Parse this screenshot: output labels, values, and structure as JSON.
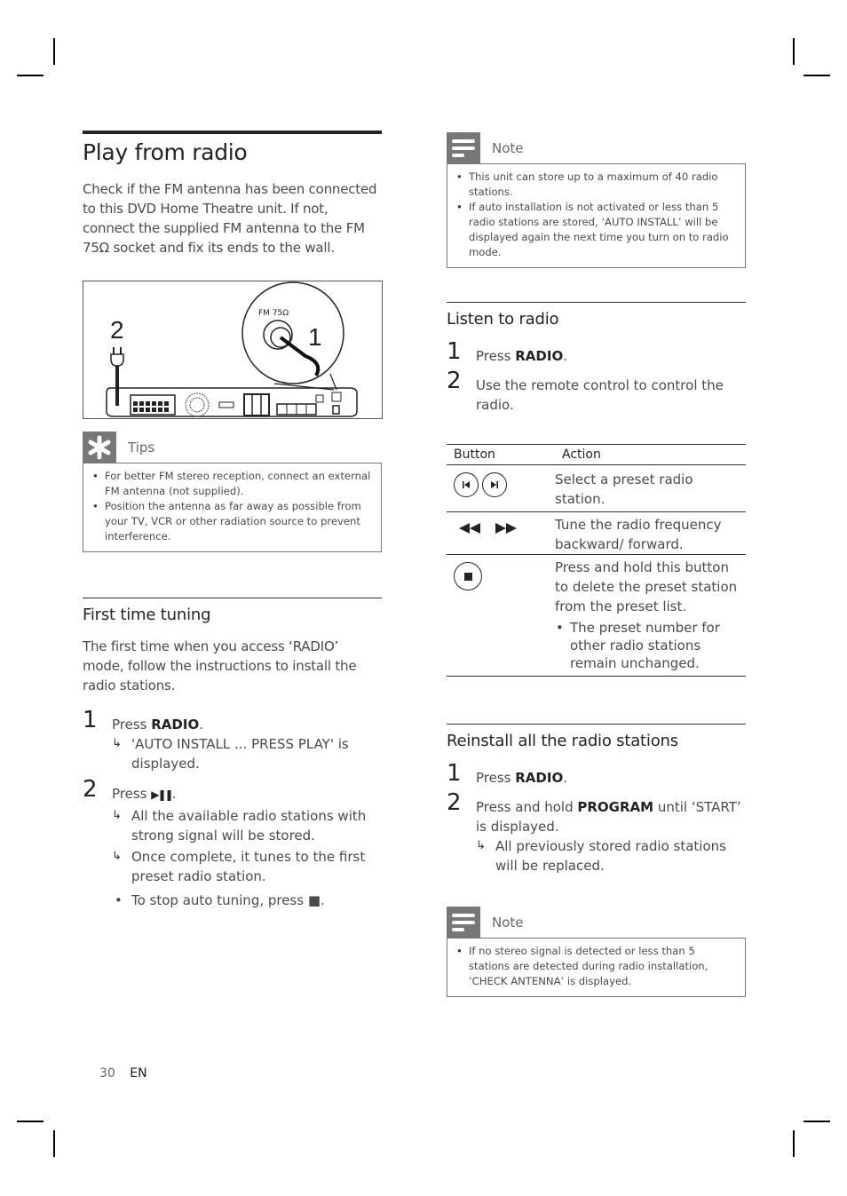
{
  "page": {
    "title": "Play from radio",
    "intro": "Check if the FM antenna has been connected to this DVD Home Theatre unit.  If not, connect the supplied FM antenna to the FM 75Ω socket and fix its ends to the wall.",
    "figure": {
      "label_socket": "FM 75Ω",
      "callout_1": "1",
      "callout_2": "2"
    },
    "tips": {
      "label": "Tips",
      "icon": "asterisk-icon",
      "items": [
        "For better FM stereo reception, connect an external FM antenna (not supplied).",
        "Position the antenna as far away as possible from your TV, VCR or other radiation source to prevent interference."
      ]
    },
    "first_time": {
      "heading": "First time tuning",
      "intro": "The first time when you access ‘RADIO’ mode, follow the instructions to install the radio stations.",
      "steps": [
        {
          "num": "1",
          "pre": "Press ",
          "key": "RADIO",
          "post": ".",
          "results": [
            "'AUTO INSTALL ... PRESS PLAY' is displayed."
          ]
        },
        {
          "num": "2",
          "pre": "Press ",
          "key": "▶❚❚",
          "post": ".",
          "results": [
            "All the available radio stations with strong signal will be stored.",
            "Once complete, it tunes to the first preset radio station."
          ],
          "bullet": "To stop auto tuning, press ■."
        }
      ]
    },
    "note1": {
      "label": "Note",
      "icon": "note-icon",
      "items": [
        "This unit can store up to a maximum of 40 radio stations.",
        "If auto installation is not activated or less than 5 radio stations are stored, ‘AUTO INSTALL’ will be displayed again the next time you turn on to radio mode."
      ]
    },
    "listen": {
      "heading": "Listen to radio",
      "steps": [
        {
          "num": "1",
          "pre": "Press ",
          "key": "RADIO",
          "post": "."
        },
        {
          "num": "2",
          "text": "Use the remote control to control the radio."
        }
      ]
    },
    "table": {
      "headers": [
        "Button",
        "Action"
      ],
      "rows": [
        {
          "buttons": [
            "previous-icon",
            "next-icon"
          ],
          "action": "Select a preset radio station."
        },
        {
          "buttons": [
            "rewind-icon",
            "fast-forward-icon"
          ],
          "action": "Tune the radio frequency backward/ forward."
        },
        {
          "buttons": [
            "stop-icon"
          ],
          "action": "Press and hold this button to delete the preset station from the preset list.",
          "bullet": "The preset number for other radio stations remain unchanged."
        }
      ]
    },
    "reinstall": {
      "heading": "Reinstall all the radio stations",
      "steps": [
        {
          "num": "1",
          "pre": "Press ",
          "key": "RADIO",
          "post": "."
        },
        {
          "num": "2",
          "pre": "Press and hold ",
          "key": "PROGRAM",
          "post": " until ‘START’ is displayed.",
          "results": [
            "All previously stored radio stations will be replaced."
          ]
        }
      ]
    },
    "note2": {
      "label": "Note",
      "icon": "note-icon",
      "items": [
        "If no stereo signal is detected or less than 5 stations are detected during radio installation, ‘CHECK ANTENNA’ is displayed."
      ]
    },
    "footer": {
      "page_number": "30",
      "language": "EN"
    }
  }
}
